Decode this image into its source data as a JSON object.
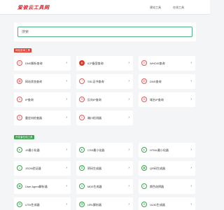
{
  "header": {
    "logo_text": "爱彼云工具网",
    "nav": [
      "建站工具",
      "在线工具"
    ]
  },
  "search": {
    "placeholder": "搜索"
  },
  "sections": [
    {
      "tag": "网站查询工具",
      "color": "#e03e2d",
      "items": [
        {
          "label": "DNS解析查询",
          "icon": "dns-icon"
        },
        {
          "label": "ICP备案查询",
          "icon": "icp-icon"
        },
        {
          "label": "WHOIS查询",
          "icon": "whois-icon"
        },
        {
          "label": "网站状态查询",
          "icon": "status-icon"
        },
        {
          "label": "SSL证书查询",
          "icon": "ssl-icon"
        },
        {
          "label": "DNS查询",
          "icon": "dns-query-icon"
        },
        {
          "label": "IP查询",
          "icon": "ip-icon"
        },
        {
          "label": "反向IP查询",
          "icon": "reverse-ip-icon"
        },
        {
          "label": "域名IP查询",
          "icon": "domain-ip-icon"
        },
        {
          "label": "重定向检查器",
          "icon": "redirect-icon"
        },
        {
          "label": "端口检测器",
          "icon": "port-icon"
        }
      ]
    },
    {
      "tag": "开发者在线工具",
      "color": "#3ca24f",
      "items": [
        {
          "label": "JS最小化器",
          "icon": "js-icon"
        },
        {
          "label": "CSS最小化器",
          "icon": "css-icon"
        },
        {
          "label": "HTML最小化器",
          "icon": "html-icon"
        },
        {
          "label": "JSON验证器",
          "icon": "json-icon"
        },
        {
          "label": "密码生成器",
          "icon": "password-icon"
        },
        {
          "label": "QR码生成器",
          "icon": "qr-icon"
        },
        {
          "label": "User Agent解析器",
          "icon": "ua-icon"
        },
        {
          "label": "MD5生成器",
          "icon": "md5-icon"
        },
        {
          "label": "颜色选择器",
          "icon": "color-icon"
        },
        {
          "label": "UTM生成器",
          "icon": "utm-icon"
        },
        {
          "label": "URL解析器",
          "icon": "url-icon"
        },
        {
          "label": "UUID生成器",
          "icon": "uuid-icon"
        }
      ]
    }
  ]
}
